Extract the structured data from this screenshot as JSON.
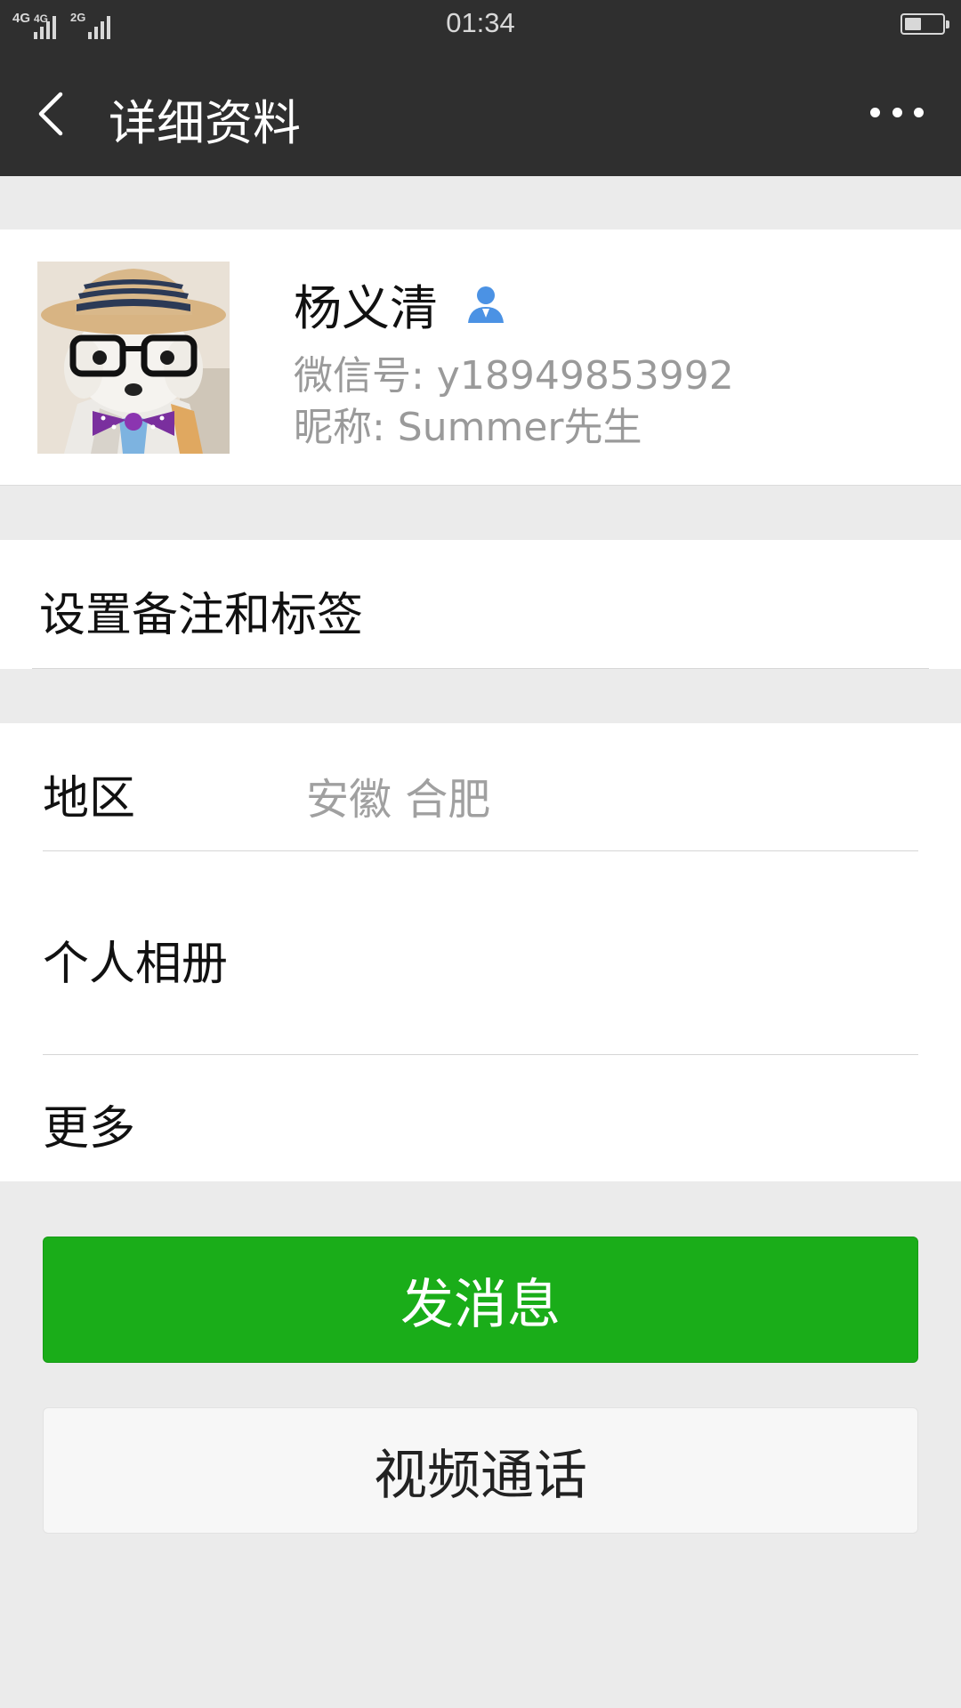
{
  "status_bar": {
    "sim1_network": "4G",
    "sim1_network_b": "4G",
    "sim2_network": "2G",
    "time": "01:34",
    "battery_level": 0.45
  },
  "header": {
    "title": "详细资料",
    "back_icon": "back-arrow-icon",
    "more_icon": "more-dots-icon"
  },
  "profile": {
    "name": "杨义清",
    "wechat_id": "微信号: y18949853992",
    "nickname": "昵称: Summer先生",
    "avatar_desc": "avatar"
  },
  "remark": {
    "label": "设置备注和标签"
  },
  "info": {
    "region_label": "地区",
    "region_value": "安徽  合肥",
    "album_label": "个人相册",
    "more_label": "更多"
  },
  "actions": {
    "send_message": "发消息",
    "video_call": "视频通话"
  },
  "colors": {
    "header_bg": "#2f2f2f",
    "primary_green": "#1aad19",
    "page_bg": "#ebebeb"
  }
}
